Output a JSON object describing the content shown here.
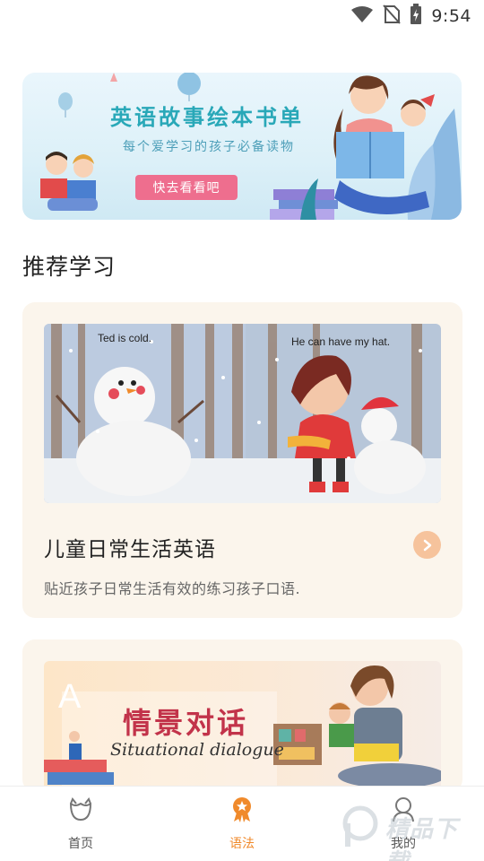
{
  "status_bar": {
    "time": "9:54",
    "icons": [
      "wifi-icon",
      "no-sim-icon",
      "battery-charging-icon"
    ]
  },
  "banner": {
    "title": "英语故事绘本书单",
    "subtitle": "每个爱学习的孩子必备读物",
    "button_label": "快去看看吧"
  },
  "section": {
    "title": "推荐学习"
  },
  "cards": [
    {
      "image_captions": [
        "Ted is cold.",
        "He can have my hat."
      ],
      "title": "儿童日常生活英语",
      "description": "贴近孩子日常生活有效的练习孩子口语.",
      "arrow_icon": "chevron-right-icon"
    },
    {
      "image_title": "情景对话",
      "image_subtitle": "Situational dialogue",
      "image_letter": "A"
    }
  ],
  "bottom_nav": {
    "items": [
      {
        "label": "首页",
        "icon": "home-face-icon"
      },
      {
        "label": "语法",
        "icon": "award-badge-icon"
      },
      {
        "label": "我的",
        "icon": "user-icon"
      }
    ],
    "active_index": 1
  },
  "watermark": {
    "text": "精品下载"
  },
  "colors": {
    "accent": "#f08a2b",
    "banner_title": "#29a8b8",
    "banner_button": "#ee6e8e",
    "card_background": "#fbf5ec",
    "arrow": "#f6c39c",
    "card2_title": "#c2334a"
  }
}
